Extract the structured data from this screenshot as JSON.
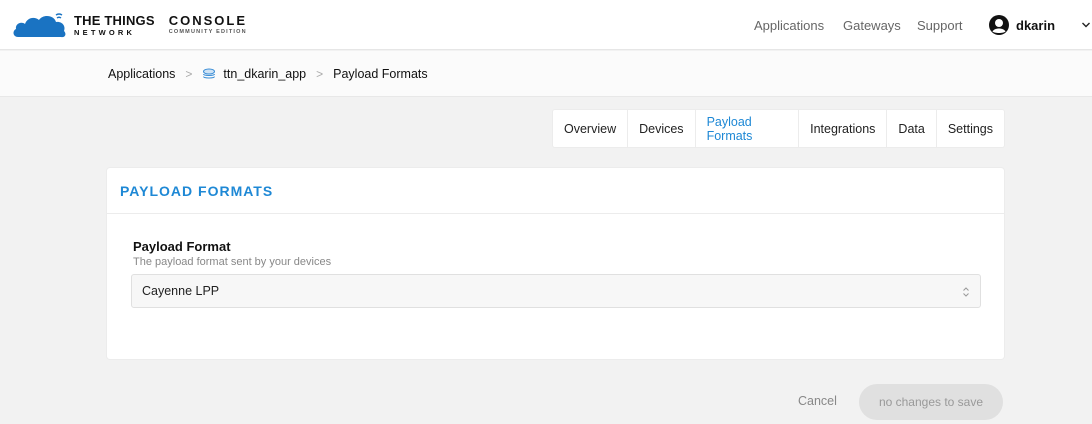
{
  "header": {
    "brand_line1": "THE THINGS",
    "brand_line2": "NETWORK",
    "console_title": "CONSOLE",
    "console_subtitle": "COMMUNITY EDITION",
    "nav": {
      "applications": "Applications",
      "gateways": "Gateways",
      "support": "Support"
    },
    "user_name": "dkarin",
    "icons": {
      "logo": "cloud-logo-icon",
      "avatar": "user-avatar-icon",
      "menu": "chevron-down-icon"
    }
  },
  "breadcrumb": {
    "items": [
      "Applications",
      "ttn_dkarin_app",
      "Payload Formats"
    ],
    "separator": ">",
    "app_icon": "application-stack-icon"
  },
  "tabs": [
    {
      "label": "Overview",
      "active": false
    },
    {
      "label": "Devices",
      "active": false
    },
    {
      "label": "Payload Formats",
      "active": true
    },
    {
      "label": "Integrations",
      "active": false
    },
    {
      "label": "Data",
      "active": false
    },
    {
      "label": "Settings",
      "active": false
    }
  ],
  "card": {
    "title": "PAYLOAD FORMATS",
    "field_label": "Payload Format",
    "field_description": "The payload format sent by your devices",
    "selected_value": "Cayenne LPP"
  },
  "actions": {
    "cancel_label": "Cancel",
    "save_label": "no changes to save"
  },
  "colors": {
    "accent": "#1e88d5",
    "logo_blue": "#1a73c2",
    "background": "#f2f2f2",
    "disabled_button": "#e0e0e0"
  }
}
